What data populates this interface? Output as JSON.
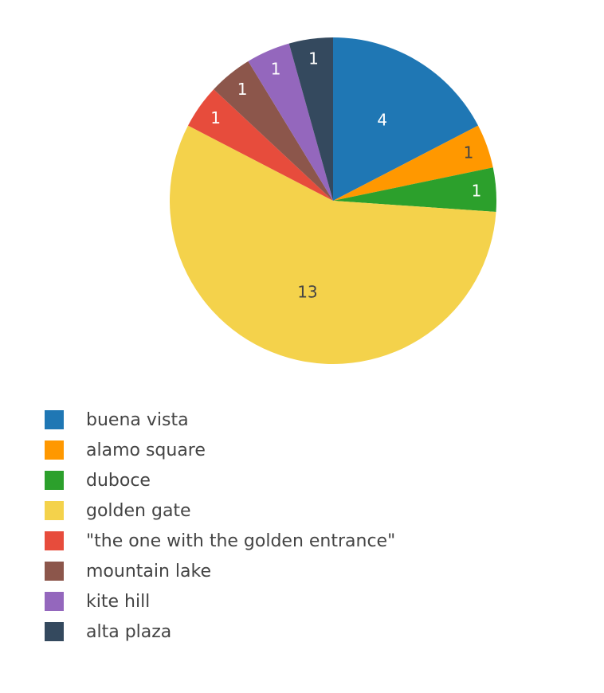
{
  "chart_data": {
    "type": "pie",
    "categories": [
      "buena vista",
      "alamo square",
      "duboce",
      "golden gate",
      "\"the one with the golden entrance\"",
      "mountain lake",
      "kite hill",
      "alta plaza"
    ],
    "values": [
      4,
      1,
      1,
      13,
      1,
      1,
      1,
      1
    ],
    "colors": [
      "#1f77b4",
      "#ff9800",
      "#2ca02c",
      "#f4d24b",
      "#e74c3c",
      "#8c564b",
      "#9467bd",
      "#34495e"
    ],
    "label_colors": [
      "#ffffff",
      "#444444",
      "#ffffff",
      "#444444",
      "#ffffff",
      "#ffffff",
      "#ffffff",
      "#ffffff"
    ],
    "start_angle_deg": 90,
    "direction": "clockwise",
    "legend_position": "bottom-left"
  }
}
